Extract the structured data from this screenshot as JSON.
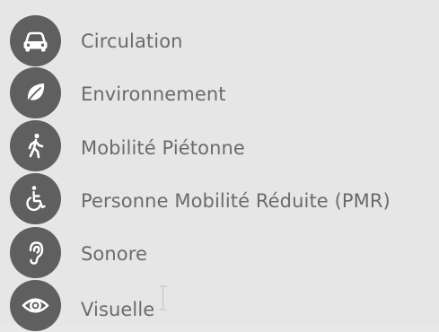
{
  "menu": {
    "items": [
      {
        "label": "Circulation",
        "icon": "car-icon"
      },
      {
        "label": "Environnement",
        "icon": "leaf-icon"
      },
      {
        "label": "Mobilité Piétonne",
        "icon": "pedestrian-icon"
      },
      {
        "label": "Personne Mobilité Réduite (PMR)",
        "icon": "wheelchair-icon"
      },
      {
        "label": "Sonore",
        "icon": "ear-icon"
      },
      {
        "label": "Visuelle",
        "icon": "eye-icon"
      }
    ]
  },
  "colors": {
    "background": "#e6e6e6",
    "icon_circle": "#5f5f5f",
    "icon_glyph": "#ffffff",
    "label_text": "#6b6b6b"
  }
}
